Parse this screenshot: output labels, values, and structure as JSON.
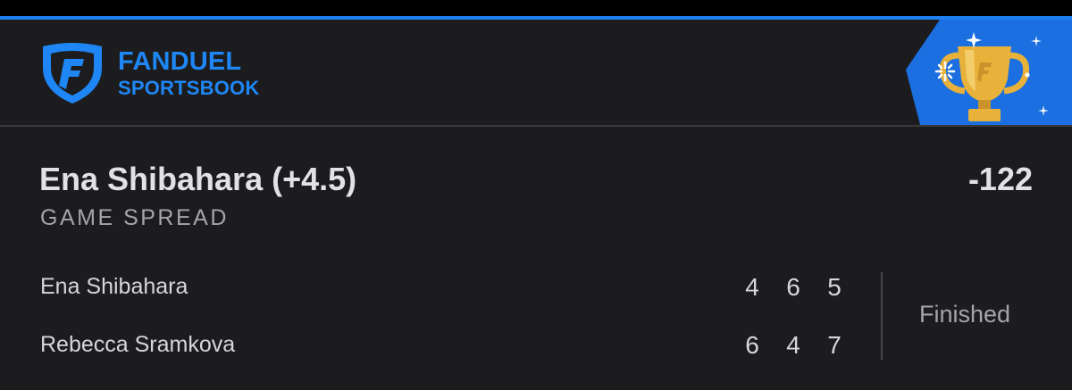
{
  "colors": {
    "background": "#1c1c1e",
    "accent_blue": "#1e7ff0",
    "brand_blue": "#1e86f5",
    "badge_blue": "#1b6fe0",
    "trophy_gold": "#e8b23a",
    "text_primary": "#e2e2e6",
    "text_secondary": "#a4a4aa"
  },
  "header": {
    "brand": "FANDUEL",
    "sub_brand": "SPORTSBOOK",
    "logo_icon": "fanduel-shield-icon",
    "badge_icon": "trophy-icon"
  },
  "bet": {
    "selection": "Ena Shibahara (+4.5)",
    "odds": "-122",
    "market": "GAME SPREAD"
  },
  "match": {
    "players": [
      {
        "name": "Ena Shibahara",
        "sets": [
          "4",
          "6",
          "5"
        ]
      },
      {
        "name": "Rebecca Sramkova",
        "sets": [
          "6",
          "4",
          "7"
        ]
      }
    ],
    "status": "Finished"
  }
}
